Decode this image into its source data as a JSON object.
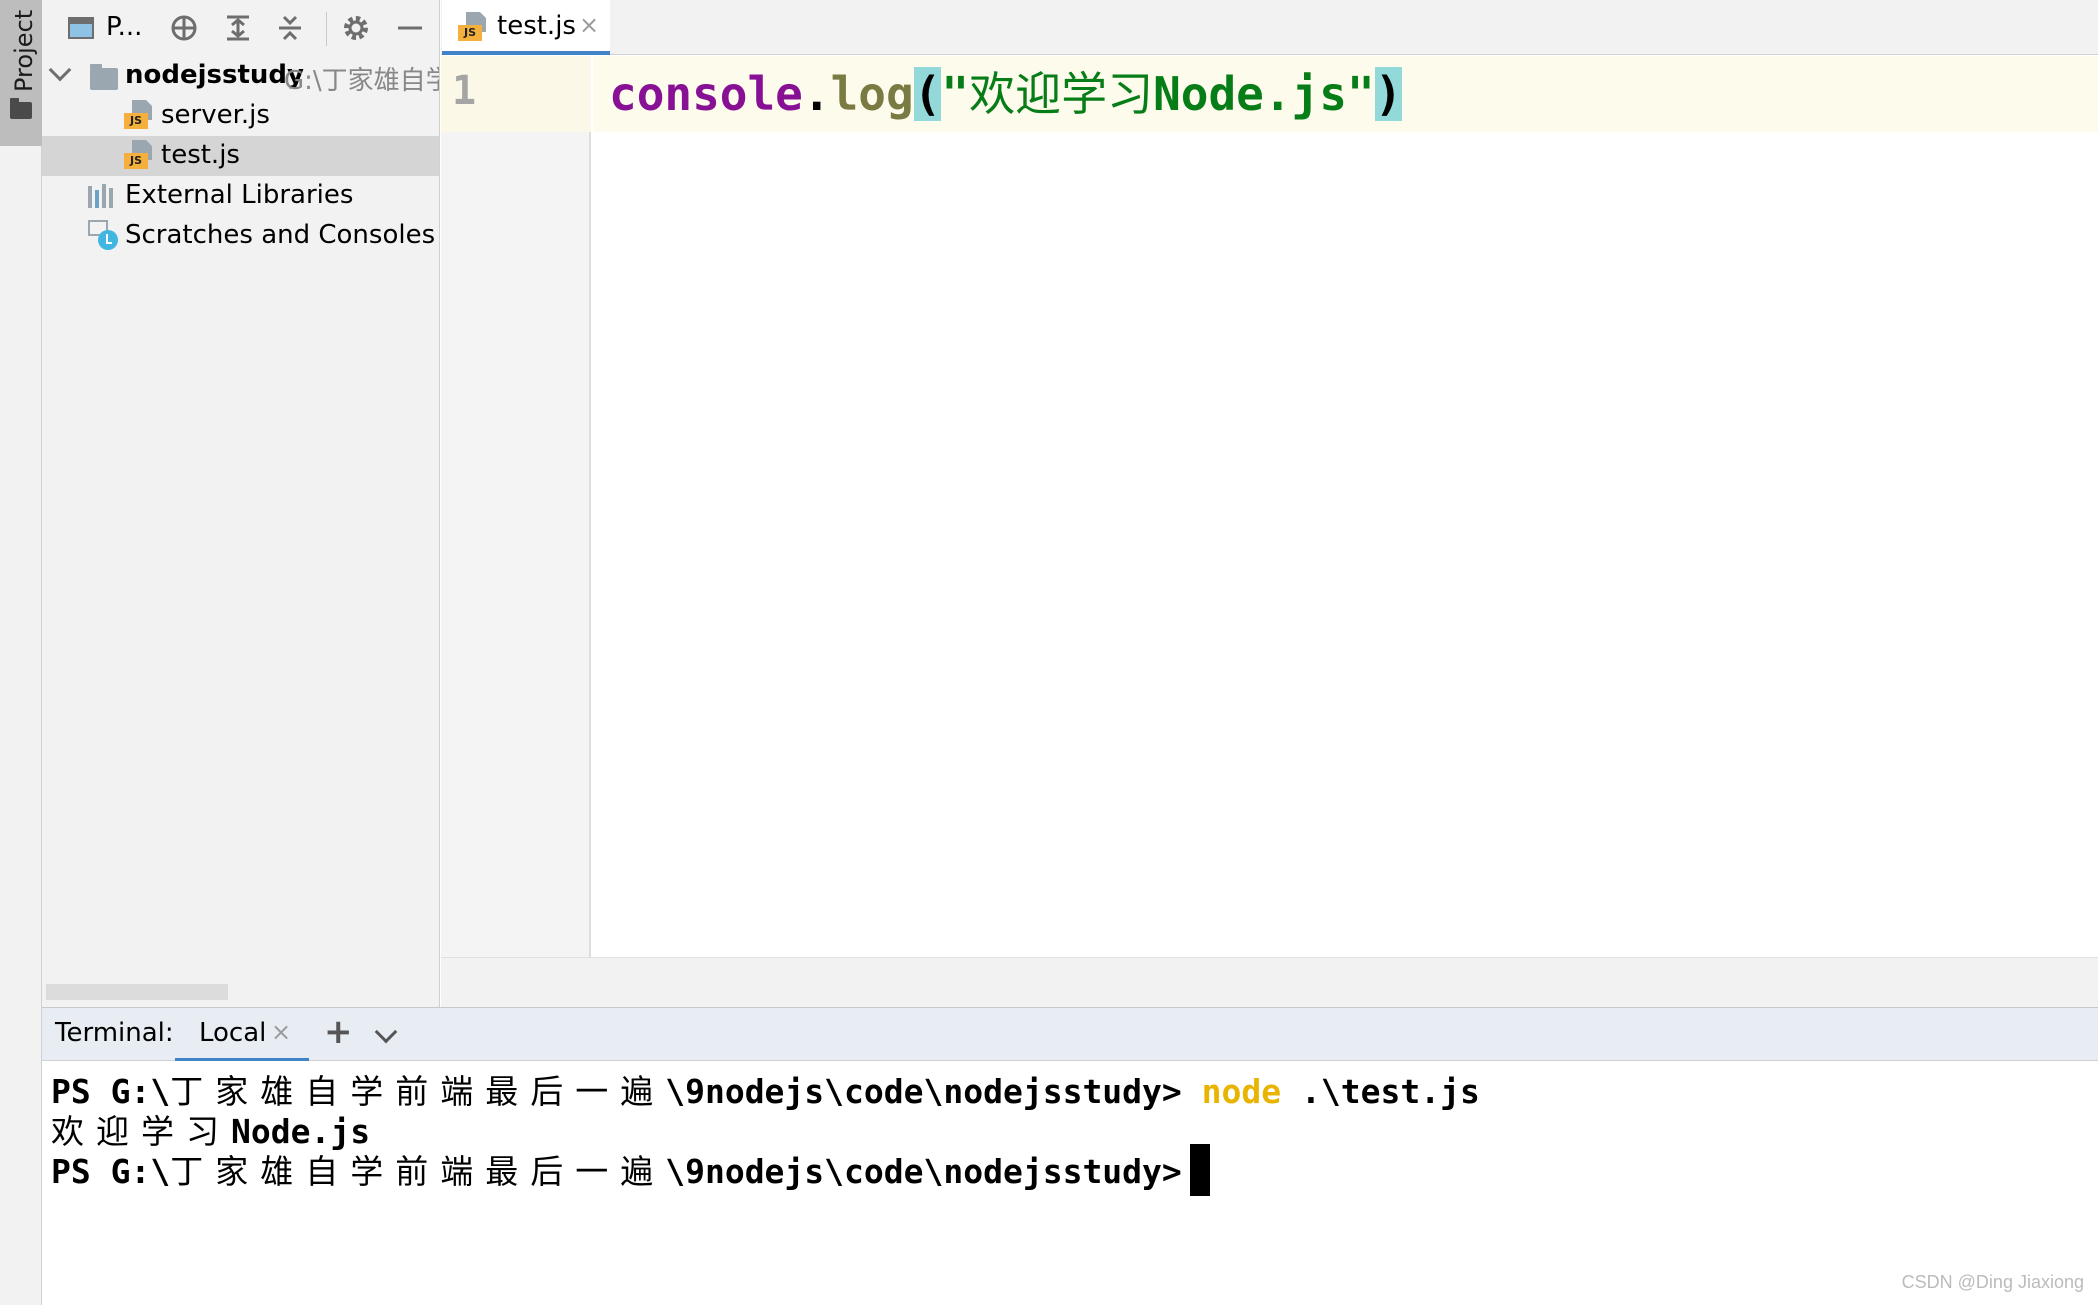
{
  "stripe": {
    "project_label": "Project"
  },
  "project_panel": {
    "title": "P...",
    "toolbar_icons": [
      "project-view-icon",
      "locate-icon",
      "expand-all-icon",
      "collapse-all-icon",
      "gear-icon",
      "minimize-icon"
    ],
    "tree": {
      "root": {
        "label": "nodejsstudy",
        "path": "G:\\丁家雄自学"
      },
      "files": [
        {
          "label": "server.js",
          "selected": false
        },
        {
          "label": "test.js",
          "selected": true
        }
      ],
      "external_libraries": "External Libraries",
      "scratches": "Scratches and Consoles"
    }
  },
  "editor": {
    "tab": {
      "label": "test.js",
      "close": "×"
    },
    "line_number": "1",
    "code": {
      "object": "console",
      "dot": ".",
      "method": "log",
      "open_paren": "(",
      "quote_open": "\"",
      "string_cjk": "欢迎学习",
      "string_ascii": "Node.js",
      "quote_close": "\"",
      "close_paren": ")"
    }
  },
  "terminal": {
    "title": "Terminal:",
    "tab_label": "Local",
    "tab_close": "×",
    "add": "+",
    "lines": {
      "l1_prefix": "PS G:\\",
      "l1_cjk": "丁家雄自学前端最后一遍",
      "l1_path": "\\9nodejs\\code\\nodejsstudy>",
      "l1_cmd": "node",
      "l1_arg": ".\\test.js",
      "l2_cjk": "欢迎学习",
      "l2_ascii": "Node.js",
      "l3_prefix": "PS G:\\",
      "l3_cjk": "丁家雄自学前端最后一遍",
      "l3_path": "\\9nodejs\\code\\nodejsstudy>"
    }
  },
  "watermark": "CSDN @Ding Jiaxiong",
  "colors": {
    "keyword_purple": "#871094",
    "method_olive": "#7a7a43",
    "string_green": "#067d17",
    "paren_highlight": "#93d9d9",
    "terminal_command": "#e8b400",
    "accent_blue": "#4083c9"
  }
}
